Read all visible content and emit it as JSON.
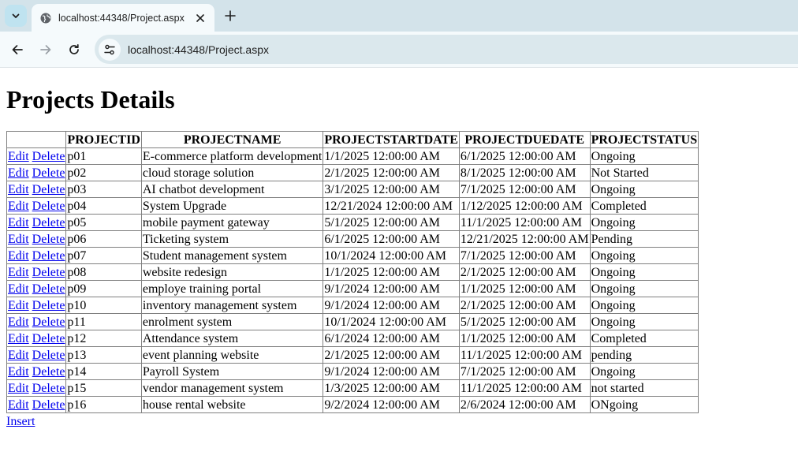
{
  "browser": {
    "tab_title": "localhost:44348/Project.aspx",
    "url": "localhost:44348/Project.aspx",
    "icons": {
      "tab_list": "chevron-down-icon",
      "favicon": "globe-icon",
      "close": "close-icon",
      "new_tab": "plus-icon",
      "back": "arrow-left-icon",
      "forward": "arrow-right-icon",
      "reload": "reload-icon",
      "site_info": "tune-icon"
    }
  },
  "page": {
    "title": "Projects Details",
    "edit_label": "Edit",
    "delete_label": "Delete",
    "insert_label": "Insert",
    "columns": [
      "",
      "PROJECTID",
      "PROJECTNAME",
      "PROJECTSTARTDATE",
      "PROJECTDUEDATE",
      "PROJECTSTATUS"
    ],
    "rows": [
      [
        "p01",
        "E-commerce platform development",
        "1/1/2025 12:00:00 AM",
        "6/1/2025 12:00:00 AM",
        "Ongoing"
      ],
      [
        "p02",
        "cloud storage solution",
        "2/1/2025 12:00:00 AM",
        "8/1/2025 12:00:00 AM",
        "Not Started"
      ],
      [
        "p03",
        "AI chatbot development",
        "3/1/2025 12:00:00 AM",
        "7/1/2025 12:00:00 AM",
        "Ongoing"
      ],
      [
        "p04",
        "System Upgrade",
        "12/21/2024 12:00:00 AM",
        "1/12/2025 12:00:00 AM",
        "Completed"
      ],
      [
        "p05",
        "mobile payment gateway",
        "5/1/2025 12:00:00 AM",
        "11/1/2025 12:00:00 AM",
        "Ongoing"
      ],
      [
        "p06",
        "Ticketing system",
        "6/1/2025 12:00:00 AM",
        "12/21/2025 12:00:00 AM",
        "Pending"
      ],
      [
        "p07",
        "Student management system",
        "10/1/2024 12:00:00 AM",
        "7/1/2025 12:00:00 AM",
        "Ongoing"
      ],
      [
        "p08",
        "website redesign",
        "1/1/2025 12:00:00 AM",
        "2/1/2025 12:00:00 AM",
        "Ongoing"
      ],
      [
        "p09",
        "employe training portal",
        "9/1/2024 12:00:00 AM",
        "1/1/2025 12:00:00 AM",
        "Ongoing"
      ],
      [
        "p10",
        "inventory management system",
        "9/1/2024 12:00:00 AM",
        "2/1/2025 12:00:00 AM",
        "Ongoing"
      ],
      [
        "p11",
        "enrolment system",
        "10/1/2024 12:00:00 AM",
        "5/1/2025 12:00:00 AM",
        "Ongoing"
      ],
      [
        "p12",
        "Attendance system",
        "6/1/2024 12:00:00 AM",
        "1/1/2025 12:00:00 AM",
        "Completed"
      ],
      [
        "p13",
        "event planning website",
        "2/1/2025 12:00:00 AM",
        "11/1/2025 12:00:00 AM",
        "pending"
      ],
      [
        "p14",
        "Payroll System",
        "9/1/2024 12:00:00 AM",
        "7/1/2025 12:00:00 AM",
        "Ongoing"
      ],
      [
        "p15",
        "vendor management system",
        "1/3/2025 12:00:00 AM",
        "11/1/2025 12:00:00 AM",
        "not started"
      ],
      [
        "p16",
        "house rental website",
        "9/2/2024 12:00:00 AM",
        "2/6/2024 12:00:00 AM",
        "ONgoing"
      ]
    ]
  }
}
